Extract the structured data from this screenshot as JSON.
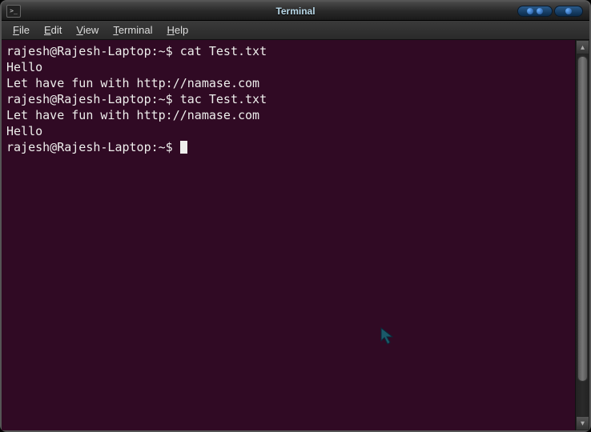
{
  "window": {
    "title": "Terminal"
  },
  "menubar": {
    "items": [
      {
        "accel": "F",
        "rest": "ile"
      },
      {
        "accel": "E",
        "rest": "dit"
      },
      {
        "accel": "V",
        "rest": "iew"
      },
      {
        "accel": "T",
        "rest": "erminal"
      },
      {
        "accel": "H",
        "rest": "elp"
      }
    ]
  },
  "terminal": {
    "prompt": "rajesh@Rajesh-Laptop:~$ ",
    "lines": [
      {
        "prompt": true,
        "text": "cat Test.txt"
      },
      {
        "prompt": false,
        "text": "Hello"
      },
      {
        "prompt": false,
        "text": "Let have fun with http://namase.com"
      },
      {
        "prompt": true,
        "text": "tac Test.txt"
      },
      {
        "prompt": false,
        "text": "Let have fun with http://namase.com"
      },
      {
        "prompt": false,
        "text": "Hello"
      },
      {
        "prompt": true,
        "text": "",
        "cursor": true
      }
    ]
  },
  "colors": {
    "terminal_bg": "#300a24",
    "terminal_fg": "#eeeeec"
  }
}
